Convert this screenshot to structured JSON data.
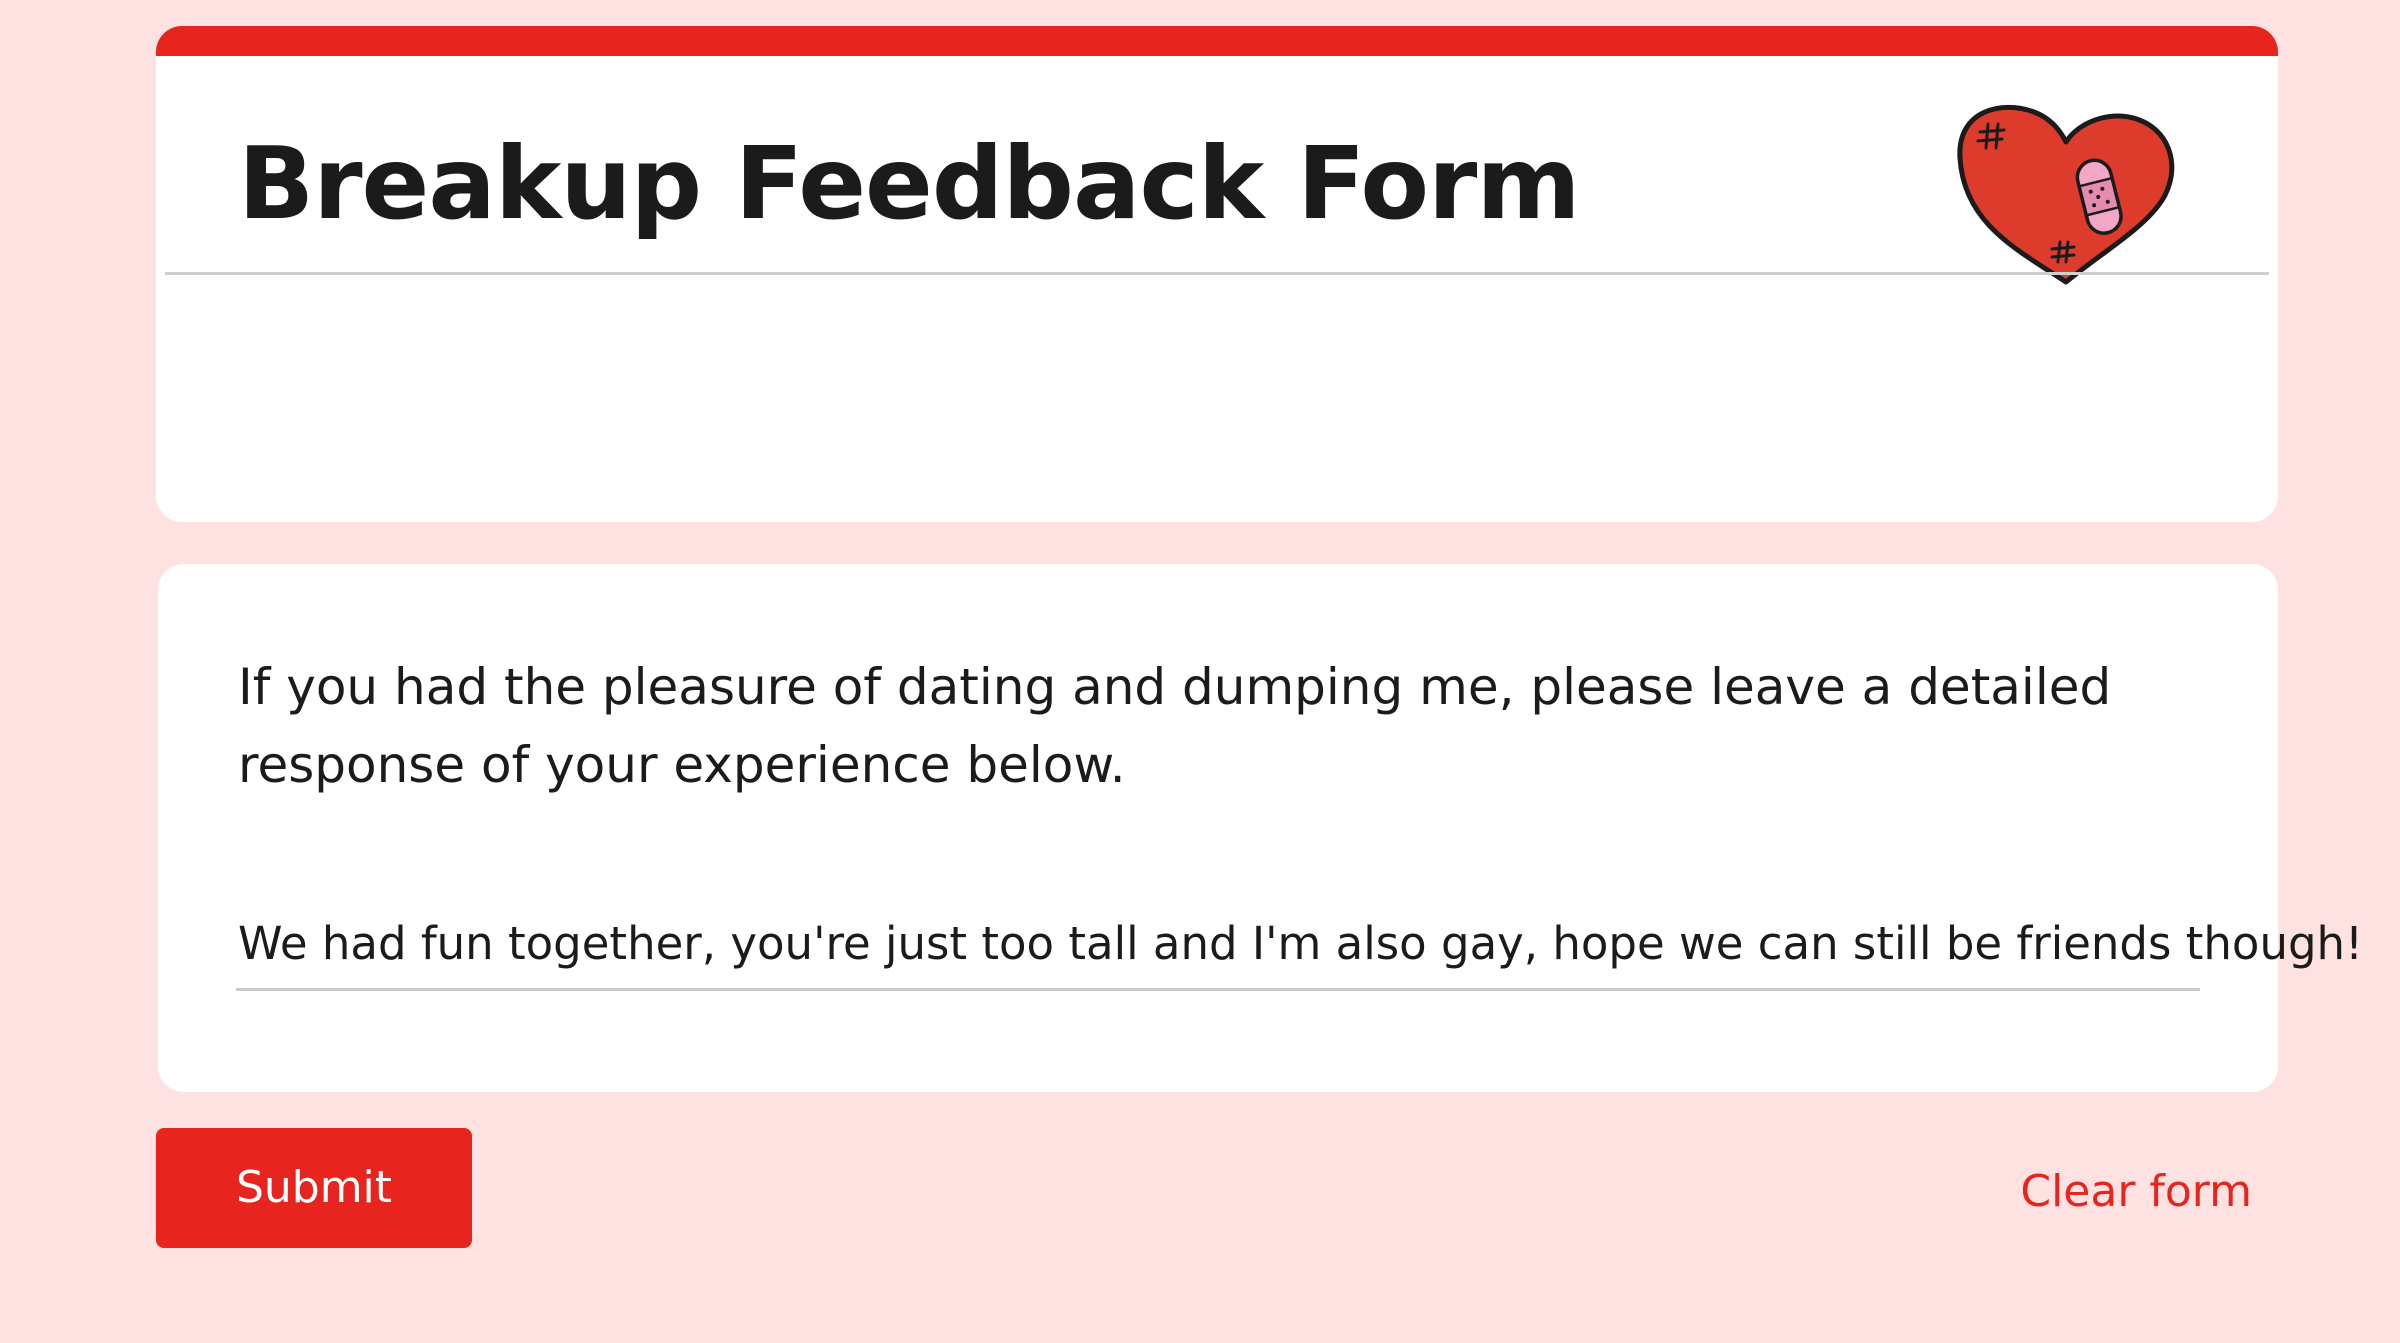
{
  "form": {
    "title": "Breakup Feedback Form"
  },
  "question": {
    "prompt": "If you had the pleasure of dating and dumping me, please leave a detailed response of your experience below.",
    "answer": "We had fun together, you're just too tall and I'm also gay, hope we can still be friends though!"
  },
  "actions": {
    "submit_label": "Submit",
    "clear_label": "Clear form"
  },
  "icons": {
    "header_icon": "bandaged-heart-icon"
  },
  "colors": {
    "accent": "#e8241f",
    "background": "#fde2e1",
    "card": "#ffffff",
    "heart_fill": "#dd3c2c",
    "bandage": "#f2a7c4"
  }
}
